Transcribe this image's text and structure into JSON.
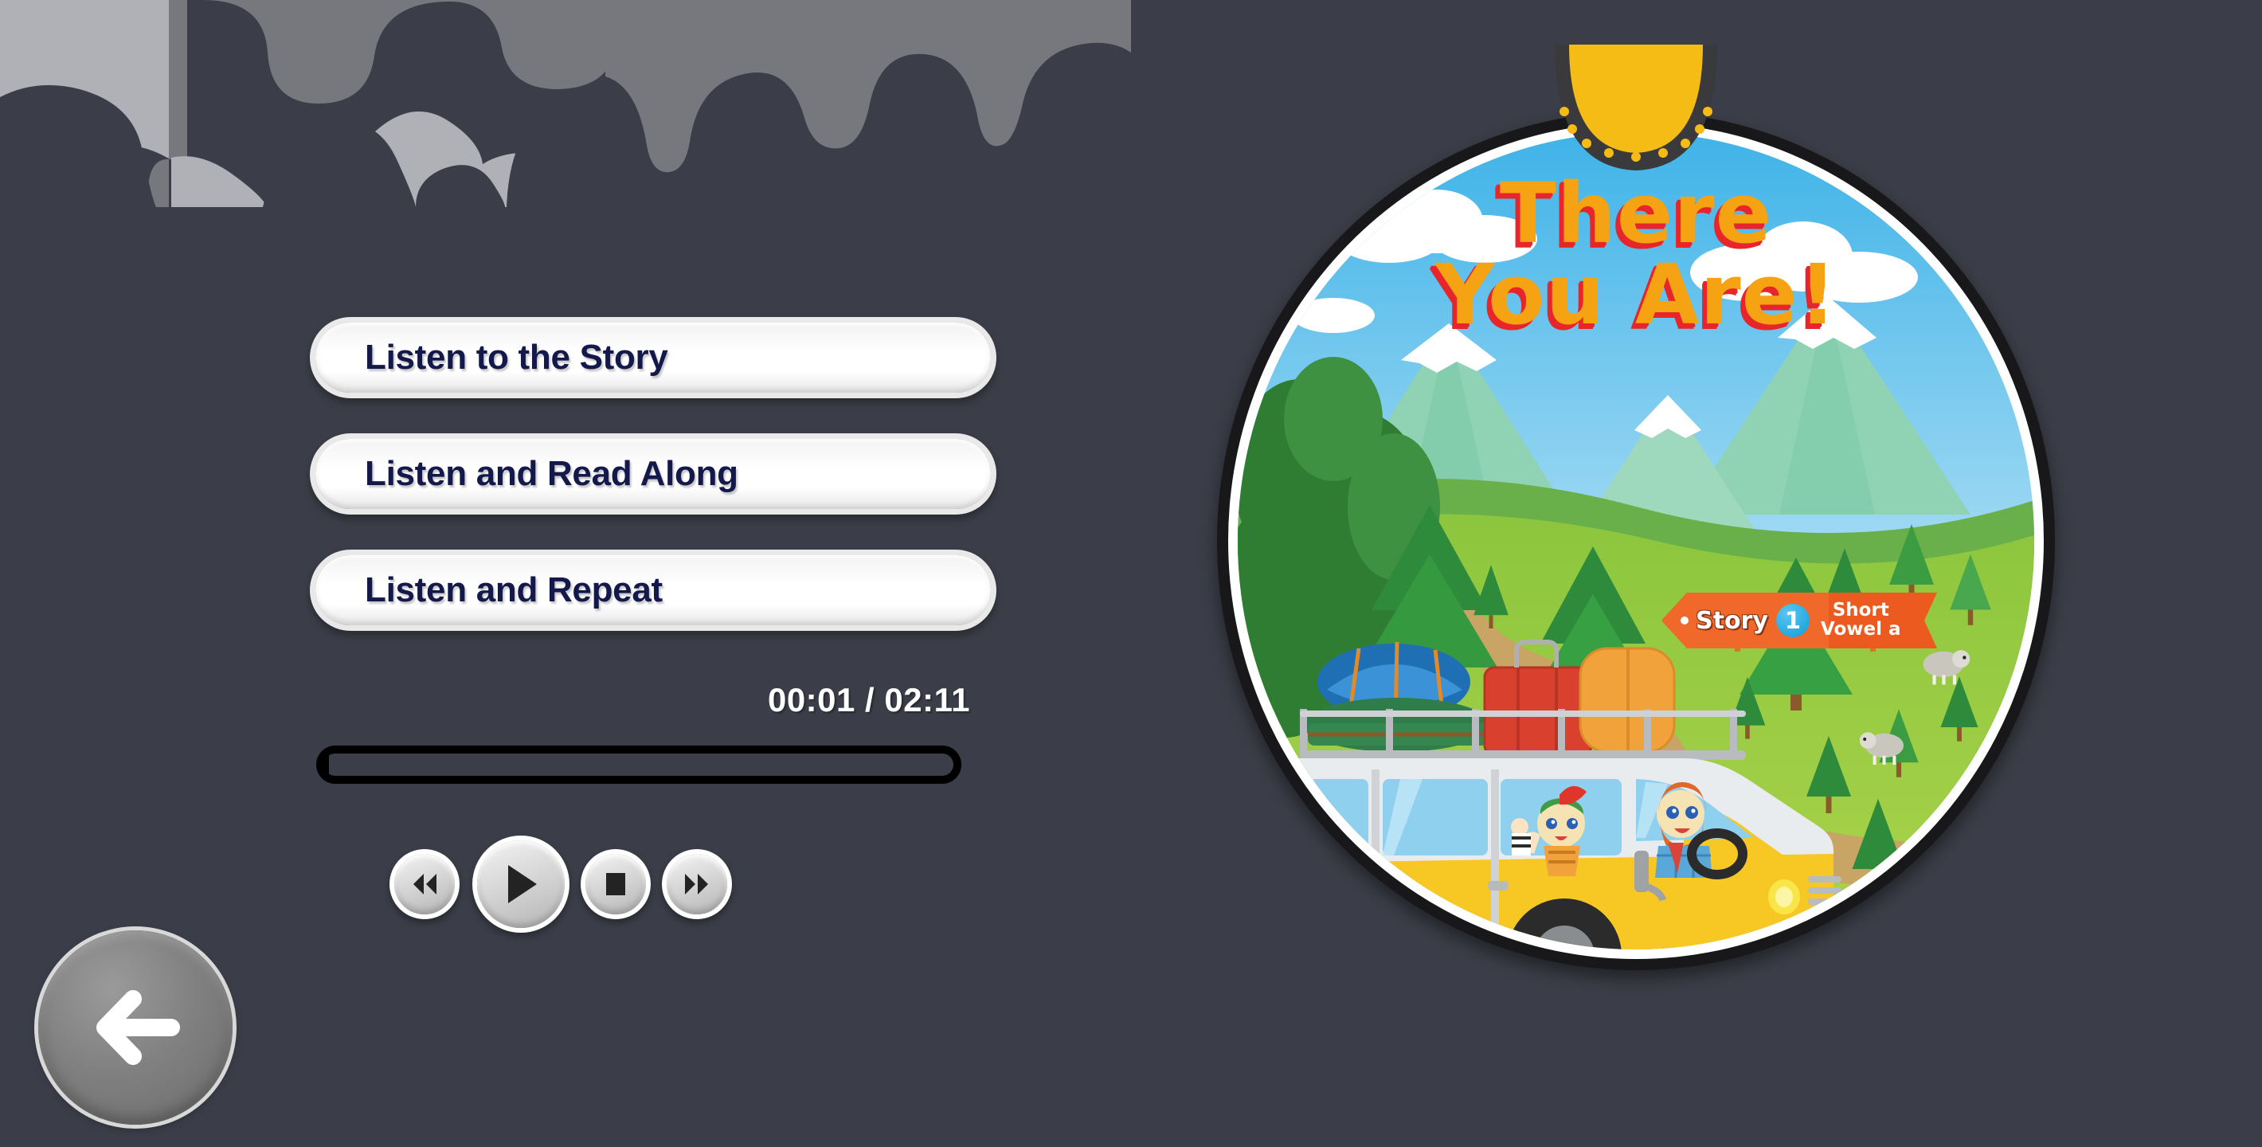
{
  "app": {
    "background_color": "#3b3e48",
    "cloud_dark_color": "#76787e",
    "cloud_light_color": "#afb1b6"
  },
  "modes": {
    "items": [
      {
        "id": "listen-to-the-story",
        "label": "Listen to the Story"
      },
      {
        "id": "listen-and-read-along",
        "label": "Listen and Read Along"
      },
      {
        "id": "listen-and-repeat",
        "label": "Listen and Repeat"
      }
    ]
  },
  "player": {
    "time_current": "00:01",
    "time_separator": "/",
    "time_total": "02:11",
    "time_display": "00:01 / 02:11",
    "progress_percent": 0.8,
    "controls": [
      {
        "id": "rewind",
        "icon": "rewind-icon",
        "label": "Rewind"
      },
      {
        "id": "play",
        "icon": "play-icon",
        "label": "Play"
      },
      {
        "id": "stop",
        "icon": "stop-icon",
        "label": "Stop"
      },
      {
        "id": "forward",
        "icon": "fast-forward-icon",
        "label": "Fast Forward"
      }
    ]
  },
  "navigation": {
    "back_button_label": "Back",
    "back_icon": "arrow-left-icon"
  },
  "cover": {
    "title_line1": "There",
    "title_line2": "You Are!",
    "title_color": "#f5a313",
    "title_outline_color": "#e8252a",
    "badge": {
      "story_label": "Story",
      "story_number": "1",
      "subtitle_line1": "Short",
      "subtitle_line2": "Vowel a",
      "banner_color": "#ec5a1f",
      "number_circle_color": "#25a9e0"
    },
    "top_emblem_color": "#f6bc16",
    "sky_color": "#55bdee",
    "grass_color": "#8dc63f"
  }
}
